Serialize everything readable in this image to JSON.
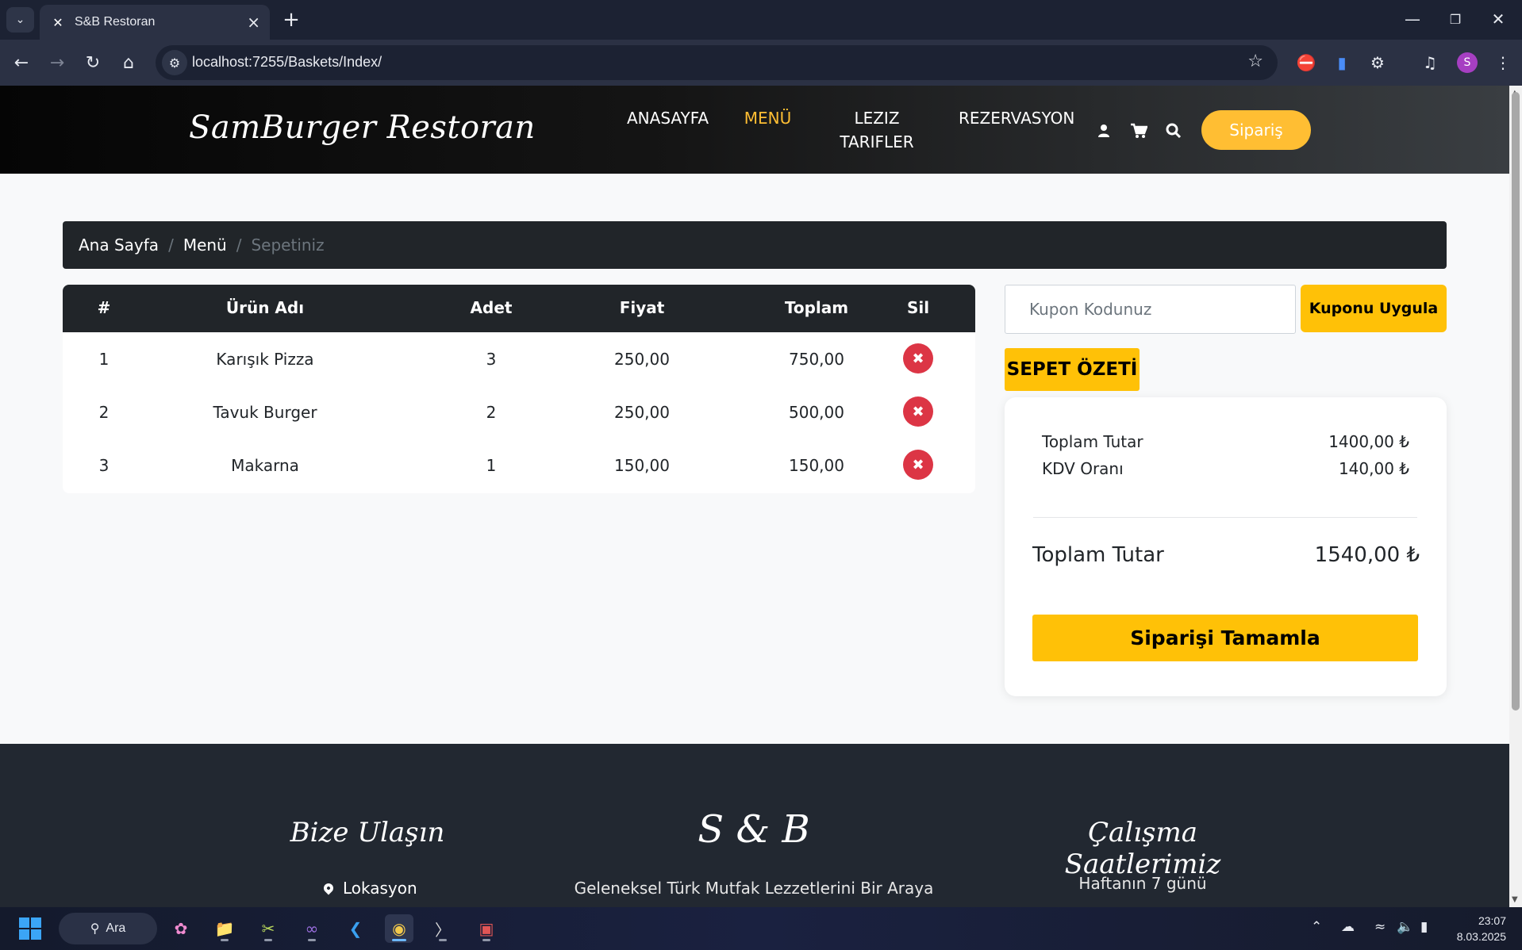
{
  "browser": {
    "tab_title": "S&B Restoran",
    "url": "localhost:7255/Baskets/Index/",
    "profile_initial": "S"
  },
  "header": {
    "brand": "SamBurger Restoran",
    "nav": [
      {
        "label": "ANASAYFA",
        "active": false
      },
      {
        "label": "MENÜ",
        "active": true
      },
      {
        "label": "LEZIZ TARIFLER",
        "active": false
      },
      {
        "label": "REZERVASYON",
        "active": false
      }
    ],
    "icons": [
      "user-icon",
      "cart-icon",
      "search-icon"
    ],
    "order_button": "Sipariş"
  },
  "breadcrumb": {
    "items": [
      "Ana Sayfa",
      "Menü"
    ],
    "active": "Sepetiniz"
  },
  "basket": {
    "columns": [
      "#",
      "Ürün Adı",
      "Adet",
      "Fiyat",
      "Toplam",
      "Sil"
    ],
    "rows": [
      {
        "no": "1",
        "name": "Karışık Pizza",
        "qty": "3",
        "price": "250,00",
        "total": "750,00"
      },
      {
        "no": "2",
        "name": "Tavuk Burger",
        "qty": "2",
        "price": "250,00",
        "total": "500,00"
      },
      {
        "no": "3",
        "name": "Makarna",
        "qty": "1",
        "price": "150,00",
        "total": "150,00"
      }
    ]
  },
  "coupon": {
    "placeholder": "Kupon Kodunuz",
    "button": "Kuponu Uygula"
  },
  "summary": {
    "badge": "SEPET ÖZETİ",
    "subtotal_label": "Toplam Tutar",
    "subtotal_value": "1400,00 ₺",
    "vat_label": "KDV Oranı",
    "vat_value": "140,00 ₺",
    "total_label": "Toplam Tutar",
    "total_value": "1540,00 ₺",
    "complete_button": "Siparişi Tamamla"
  },
  "footer": {
    "contact_title": "Bize Ulaşın",
    "location": "Lokasyon",
    "logo_title": "S & B",
    "tagline": "Geleneksel Türk Mutfak Lezzetlerini Bir Araya",
    "hours_title": "Çalışma Saatlerimiz",
    "hours_text": "Haftanın 7 günü"
  },
  "taskbar": {
    "search_label": "Ara",
    "time": "23:07",
    "date": "8.03.2025"
  },
  "colors": {
    "accent": "#ffbe33",
    "warning": "#ffc107",
    "danger": "#dc3545",
    "dark": "#212529",
    "footer_bg": "#222831"
  }
}
